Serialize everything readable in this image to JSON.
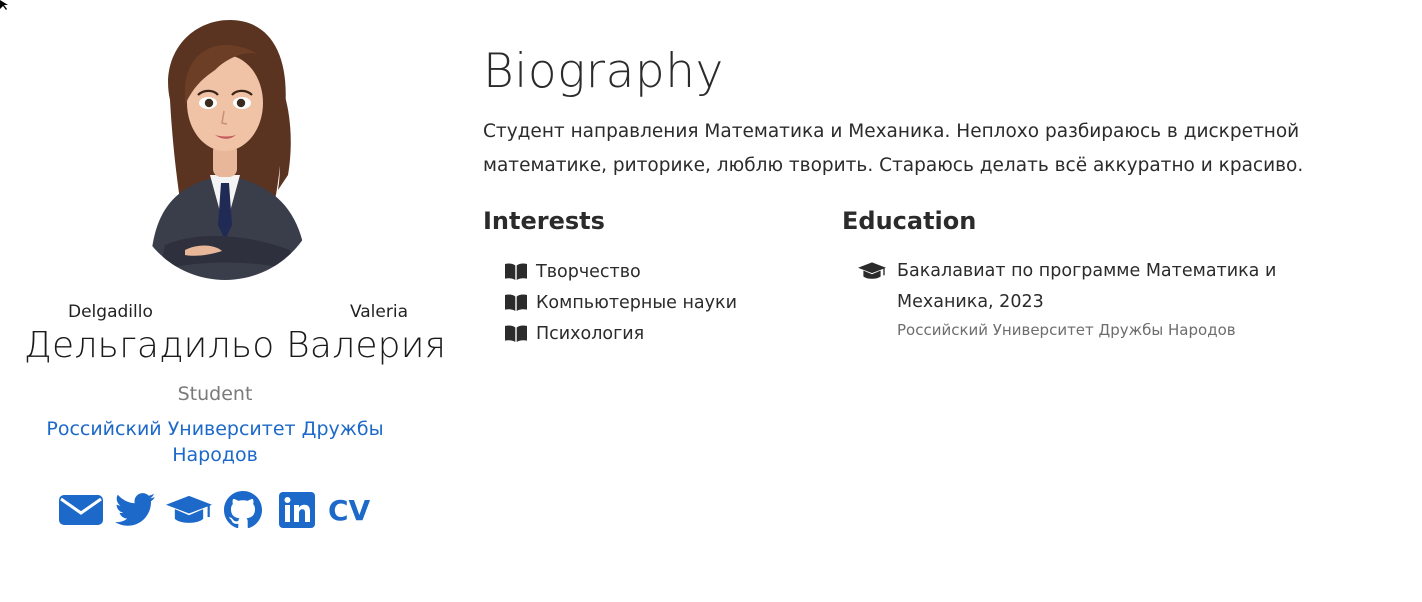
{
  "profile": {
    "last_name": "Delgadillo",
    "first_name": "Valeria",
    "full_name": "Дельгадильо Валерия",
    "role": "Student",
    "organization": "Российский Университет Дружбы Народов",
    "social": [
      {
        "icon": "envelope-icon"
      },
      {
        "icon": "twitter-icon"
      },
      {
        "icon": "graduation-cap-icon"
      },
      {
        "icon": "github-icon"
      },
      {
        "icon": "linkedin-icon"
      },
      {
        "label": "CV"
      }
    ]
  },
  "biography": {
    "title": "Biography",
    "text": "Студент направления Математика и Механика. Неплохо разбираюсь в дискретной математике, риторике, люблю творить. Стараюсь делать всё аккуратно и красиво."
  },
  "interests": {
    "title": "Interests",
    "icon": "book-icon",
    "items": [
      "Творчество",
      "Компьютерные науки",
      "Психология"
    ]
  },
  "education": {
    "title": "Education",
    "icon": "graduation-cap-icon",
    "items": [
      {
        "degree": "Бакалавиат по программе Математика и Механика, 2023",
        "school": "Российский Университет Дружбы Народов"
      }
    ]
  },
  "colors": {
    "accent": "#1c69c9",
    "text": "#2b2b2b",
    "muted": "#7a7a7a"
  }
}
